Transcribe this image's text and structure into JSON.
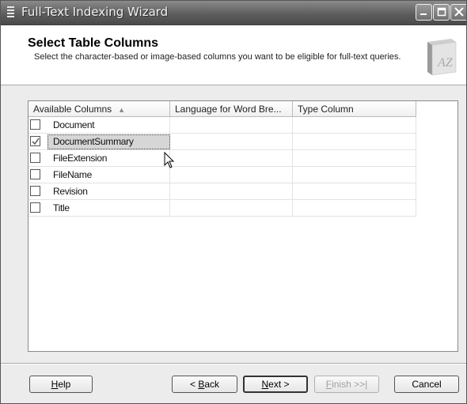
{
  "window": {
    "title": "Full-Text Indexing Wizard",
    "controls": [
      "minimize-icon",
      "maximize-icon",
      "close-icon"
    ]
  },
  "header": {
    "title": "Select Table Columns",
    "description": "Select the character-based or image-based columns you want to be eligible for full-text queries.",
    "icon": "az-book-icon",
    "icon_text": "AZ"
  },
  "table": {
    "columns": [
      "Available Columns",
      "Language for Word Bre...",
      "Type Column"
    ],
    "sort_indicator": "▲",
    "rows": [
      {
        "name": "Document",
        "checked": false
      },
      {
        "name": "DocumentSummary",
        "checked": true,
        "selected": true
      },
      {
        "name": "FileExtension",
        "checked": false
      },
      {
        "name": "FileName",
        "checked": false
      },
      {
        "name": "Revision",
        "checked": false
      },
      {
        "name": "Title",
        "checked": false
      }
    ]
  },
  "buttons": {
    "help": {
      "prefix": "",
      "mnemonic": "H",
      "rest": "elp"
    },
    "back": {
      "prefix": "< ",
      "mnemonic": "B",
      "rest": "ack"
    },
    "next": {
      "prefix": "",
      "mnemonic": "N",
      "rest": "ext >"
    },
    "finish": {
      "prefix": "",
      "mnemonic": "F",
      "rest": "inish >>|"
    },
    "cancel": {
      "prefix": "",
      "mnemonic": "",
      "rest": "Cancel"
    }
  }
}
